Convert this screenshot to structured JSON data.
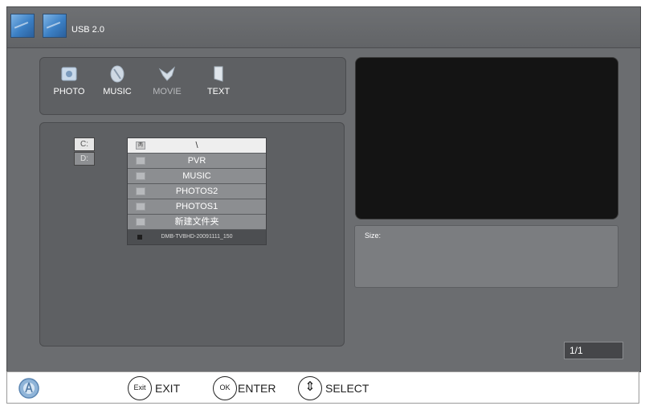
{
  "header": {
    "source_label": "USB 2.0",
    "icons": [
      "usb-disk-icon",
      "usb-disk-icon"
    ]
  },
  "media_types": [
    {
      "label": "PHOTO",
      "icon": "photo-icon",
      "state": "enabled"
    },
    {
      "label": "MUSIC",
      "icon": "music-icon",
      "state": "enabled"
    },
    {
      "label": "MOVIE",
      "icon": "movie-icon",
      "state": "dimmed"
    },
    {
      "label": "TEXT",
      "icon": "text-icon",
      "state": "enabled"
    }
  ],
  "drives": [
    {
      "label": "C:",
      "active": true
    },
    {
      "label": "D:",
      "active": false
    }
  ],
  "files": [
    {
      "name": "\\",
      "type": "parent",
      "icon_text": "两",
      "selected": true
    },
    {
      "name": "PVR",
      "type": "folder"
    },
    {
      "name": "MUSIC",
      "type": "folder"
    },
    {
      "name": "PHOTOS2",
      "type": "folder"
    },
    {
      "name": "PHOTOS1",
      "type": "folder"
    },
    {
      "name": "新建文件夹",
      "type": "folder"
    },
    {
      "name": "DMB-TVBHD-20091111_150",
      "type": "file"
    }
  ],
  "info": {
    "size_label": "Size:"
  },
  "pagination": {
    "text": "1/1"
  },
  "footer": {
    "hints": [
      {
        "key": "Exit",
        "label": "EXIT"
      },
      {
        "key": "OK",
        "label": "ENTER"
      },
      {
        "key": "⇕",
        "label": "SELECT"
      }
    ]
  },
  "colors": {
    "screen_bg": "#6b6d70",
    "panel_bg": "#5e6063",
    "preview_bg": "#141414",
    "selected_row": "#eeeeee"
  }
}
